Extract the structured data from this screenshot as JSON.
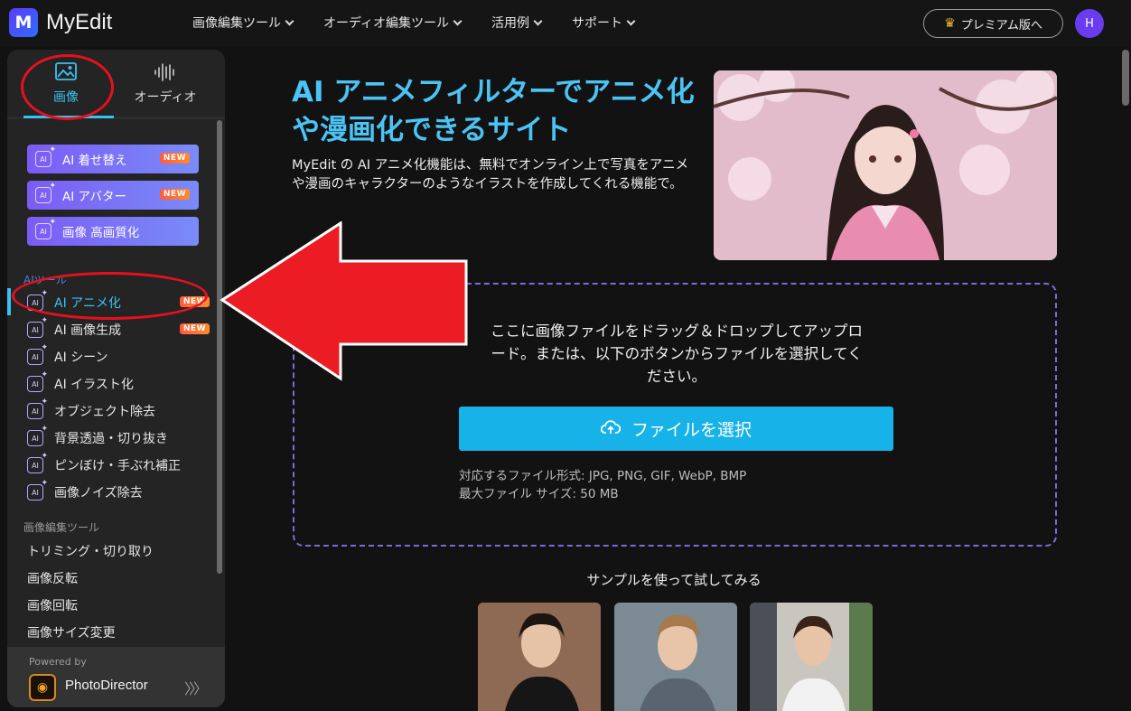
{
  "header": {
    "logo_text": "MyEdit",
    "nav": [
      {
        "label": "画像編集ツール"
      },
      {
        "label": "オーディオ編集ツール"
      },
      {
        "label": "活用例"
      },
      {
        "label": "サポート"
      }
    ],
    "premium_label": "プレミアム版へ",
    "avatar_initial": "H"
  },
  "sidebar": {
    "tabs": [
      {
        "label": "画像",
        "active": true
      },
      {
        "label": "オーディオ",
        "active": false
      }
    ],
    "featured": [
      {
        "label": "AI 着せ替え",
        "badge": "NEW"
      },
      {
        "label": "AI アバター",
        "badge": "NEW"
      },
      {
        "label": "画像 高画質化",
        "badge": ""
      }
    ],
    "ai_section_label": "AIツール",
    "ai_tools": [
      {
        "label": "AI アニメ化",
        "badge": "NEW",
        "active": true
      },
      {
        "label": "AI 画像生成",
        "badge": "NEW",
        "active": false
      },
      {
        "label": "AI シーン",
        "badge": "",
        "active": false
      },
      {
        "label": "AI イラスト化",
        "badge": "",
        "active": false
      },
      {
        "label": "オブジェクト除去",
        "badge": "",
        "active": false
      },
      {
        "label": "背景透過・切り抜き",
        "badge": "",
        "active": false
      },
      {
        "label": "ピンぼけ・手ぶれ補正",
        "badge": "",
        "active": false
      },
      {
        "label": "画像ノイズ除去",
        "badge": "",
        "active": false
      }
    ],
    "edit_section_label": "画像編集ツール",
    "edit_tools": [
      {
        "label": "トリミング・切り取り"
      },
      {
        "label": "画像反転"
      },
      {
        "label": "画像回転"
      },
      {
        "label": "画像サイズ変更"
      }
    ],
    "powered_by": "Powered by",
    "powered_product": "PhotoDirector"
  },
  "main": {
    "title": "AI アニメフィルターでアニメ化や漫画化できるサイト",
    "description": "MyEdit の AI アニメ化機能は、無料でオンライン上で写真をアニメや漫画のキャラクターのようなイラストを作成してくれる機能で。",
    "upload": {
      "instruction": "ここに画像ファイルをドラッグ＆ドロップしてアップロード。または、以下のボタンからファイルを選択してください。",
      "button_label": "ファイルを選択",
      "formats": "対応するファイル形式: JPG, PNG, GIF, WebP, BMP",
      "max_size": "最大ファイル サイズ: 50 MB"
    },
    "samples_title": "サンプルを使って試してみる"
  },
  "colors": {
    "accent": "#39c2f0",
    "annotation": "#e8101e"
  }
}
